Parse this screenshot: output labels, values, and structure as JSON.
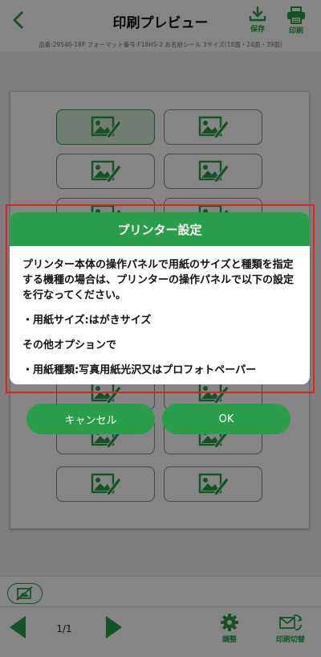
{
  "header": {
    "title": "印刷プレビュー",
    "save_label": "保存",
    "print_label": "印刷",
    "product_info": "品番:29546-18P フォーマット番号:F18HS-2 お名前シール 3サイズ(18面・24面・39面)"
  },
  "sheet": {
    "selected_index": 0
  },
  "dialog": {
    "title": "プリンター設定",
    "message": "プリンター本体の操作パネルで用紙のサイズと種類を指定する機種の場合は、プリンターの操作パネルで以下の設定を行なってください。",
    "paper_size": "・用紙サイズ:はがきサイズ",
    "other_options": "その他オプションで",
    "paper_type": "・用紙種類:写真用紙光沢又はプロフォトペーパー",
    "cancel_label": "キャンセル",
    "ok_label": "OK"
  },
  "bottom_bar": {
    "page_indicator": "1/1",
    "adjust_label": "調整",
    "switch_label": "印刷切替"
  },
  "colors": {
    "accent": "#2a9d4a",
    "highlight": "#e02424"
  }
}
